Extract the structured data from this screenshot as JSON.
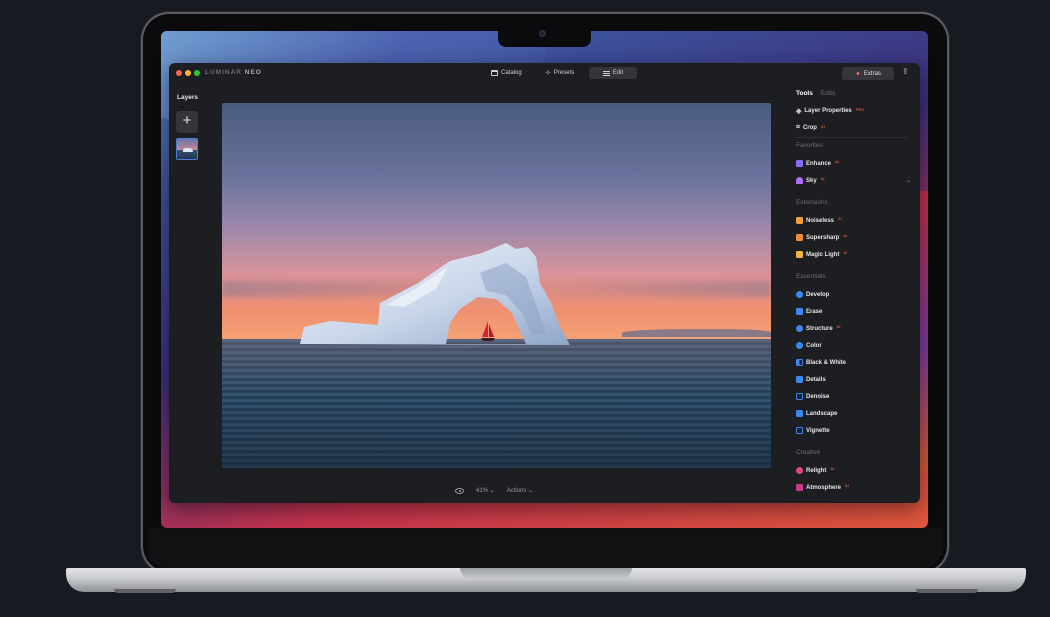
{
  "app": {
    "logo_text_dim": "LUMINAR",
    "logo_text_bright": "NEO",
    "nav": [
      {
        "label": "Catalog",
        "icon": "catalog-icon"
      },
      {
        "label": "Presets",
        "icon": "presets-icon"
      },
      {
        "label": "Edit",
        "icon": "edit-icon",
        "active": true
      }
    ],
    "extras_label": "Extras",
    "share_icon": "share-icon"
  },
  "layers": {
    "title": "Layers",
    "add_label": "+"
  },
  "canvas": {
    "zoom_label": "41% ⌄",
    "actions_label": "Actions ⌄"
  },
  "panel": {
    "tabs": [
      "Tools",
      "Edits"
    ],
    "top_tools": [
      {
        "label": "Layer Properties",
        "badge": "PRO",
        "icon": "layers-icon"
      },
      {
        "label": "Crop",
        "badge": "AI",
        "icon": "crop-icon"
      }
    ],
    "sections": {
      "favorites": "Favorites",
      "extensions": "Extensions",
      "essentials": "Essentials",
      "creative": "Creative"
    },
    "favorites": [
      {
        "label": "Enhance",
        "badge": "AI",
        "icon": "enhance-icon",
        "color": "#8c6cff"
      },
      {
        "label": "Sky",
        "badge": "AI",
        "icon": "sky-icon",
        "color": "#b46cff"
      }
    ],
    "extensions": [
      {
        "label": "Noiseless",
        "badge": "AI",
        "icon": "noiseless-icon",
        "color": "#f2a13a"
      },
      {
        "label": "Supersharp",
        "badge": "AI",
        "icon": "supersharp-icon",
        "color": "#f28a3a"
      },
      {
        "label": "Magic Light",
        "badge": "AI",
        "icon": "magic-light-icon",
        "color": "#f5b23c"
      }
    ],
    "essentials": [
      {
        "label": "Develop",
        "icon": "develop-icon",
        "color": "#3f86f0"
      },
      {
        "label": "Erase",
        "icon": "erase-icon",
        "color": "#3f86f0"
      },
      {
        "label": "Structure",
        "badge": "AI",
        "icon": "structure-icon",
        "color": "#3f86f0"
      },
      {
        "label": "Color",
        "icon": "color-icon",
        "color": "#3f86f0"
      },
      {
        "label": "Black & White",
        "icon": "black-white-icon",
        "color": "#3f86f0"
      },
      {
        "label": "Details",
        "icon": "details-icon",
        "color": "#3f86f0"
      },
      {
        "label": "Denoise",
        "icon": "denoise-icon",
        "color": "#3f86f0"
      },
      {
        "label": "Landscape",
        "icon": "landscape-icon",
        "color": "#3f86f0"
      },
      {
        "label": "Vignette",
        "icon": "vignette-icon",
        "color": "#3f86f0"
      }
    ],
    "creative": [
      {
        "label": "Relight",
        "badge": "AI",
        "icon": "relight-icon",
        "color": "#e0478a"
      },
      {
        "label": "Atmosphere",
        "badge": "AI",
        "icon": "atmosphere-icon",
        "color": "#c83c8a"
      }
    ]
  },
  "colors": {
    "accent": "#3f86f0",
    "badge": "#ff6d4f",
    "traffic_close": "#ff5f57",
    "traffic_min": "#febc2e",
    "traffic_max": "#28c840"
  }
}
